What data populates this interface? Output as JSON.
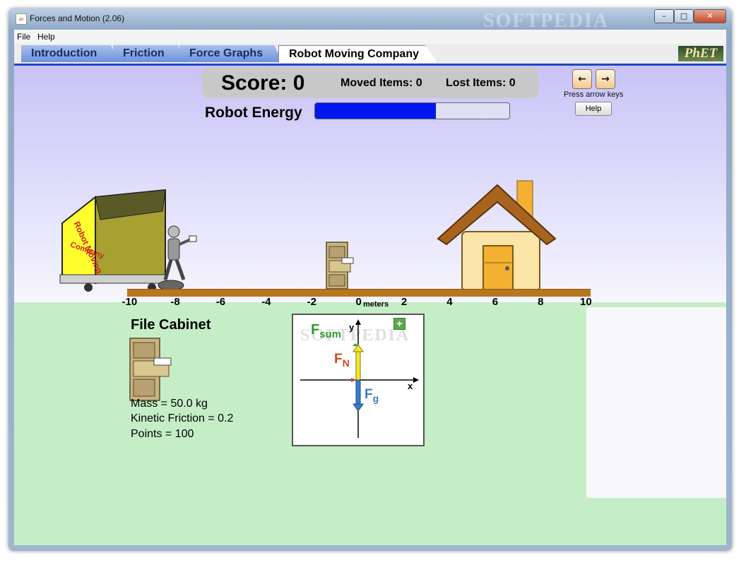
{
  "window": {
    "title": "Forces and Motion (2.06)",
    "app_icon": "java-cup-icon",
    "watermark": "SOFTPEDIA",
    "controls": {
      "minimize": "–",
      "maximize": "□",
      "close": "✕"
    }
  },
  "menu": {
    "items": [
      "File",
      "Help"
    ]
  },
  "tabs": [
    {
      "label": "Introduction",
      "active": false
    },
    {
      "label": "Friction",
      "active": false
    },
    {
      "label": "Force Graphs",
      "active": false
    },
    {
      "label": "Robot Moving Company",
      "active": true
    }
  ],
  "logo": "PhET",
  "scoreboard": {
    "score": "Score: 0",
    "moved": "Moved Items: 0",
    "lost": "Lost Items: 0"
  },
  "energy": {
    "label": "Robot Energy",
    "fraction": 0.62,
    "color": "#0018ee"
  },
  "controls_panel": {
    "left_arrow": "←",
    "right_arrow": "→",
    "hint": "Press arrow keys",
    "help": "Help"
  },
  "truck": {
    "label_line1": "Robot Moving",
    "label_line2": "Company"
  },
  "axis": {
    "ticks": [
      {
        "value": -10,
        "label": "-10"
      },
      {
        "value": -8,
        "label": "-8"
      },
      {
        "value": -6,
        "label": "-6"
      },
      {
        "value": -4,
        "label": "-4"
      },
      {
        "value": -2,
        "label": "-2"
      },
      {
        "value": 0,
        "label": "0"
      },
      {
        "value": 2,
        "label": "2"
      },
      {
        "value": 4,
        "label": "4"
      },
      {
        "value": 6,
        "label": "6"
      },
      {
        "value": 8,
        "label": "8"
      },
      {
        "value": 10,
        "label": "10"
      }
    ],
    "unit": "meters"
  },
  "item": {
    "name": "File Cabinet",
    "mass": "Mass = 50.0 kg",
    "friction": "Kinetic Friction = 0.2",
    "points": "Points = 100"
  },
  "free_body": {
    "add_button": "+",
    "watermark": "SOFTPEDIA",
    "fsum_base": "F",
    "fsum_sub": "sum",
    "fn_base": "F",
    "fn_sub": "N",
    "fg_base": "F",
    "fg_sub": "g",
    "x_label": "x",
    "y_label": "y"
  },
  "colors": {
    "sky_top": "#c9c3f7",
    "grass": "#c5eec7",
    "track": "#b8771e"
  }
}
